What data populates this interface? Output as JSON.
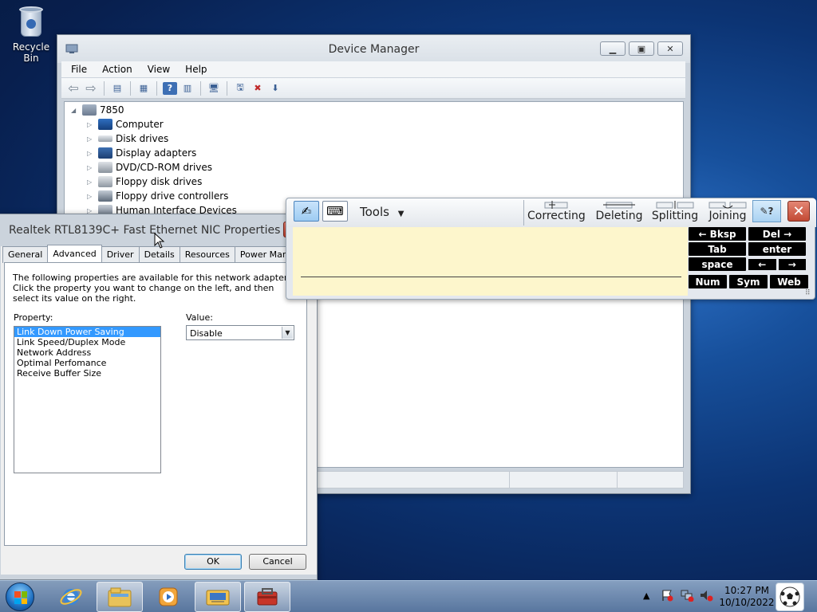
{
  "desktop": {
    "recycle_bin_label": "Recycle Bin"
  },
  "device_manager": {
    "title": "Device Manager",
    "menu": [
      "File",
      "Action",
      "View",
      "Help"
    ],
    "tree_root": "7850",
    "tree_items": [
      "Computer",
      "Disk drives",
      "Display adapters",
      "DVD/CD-ROM drives",
      "Floppy disk drives",
      "Floppy drive controllers",
      "Human Interface Devices"
    ]
  },
  "properties": {
    "title": "Realtek RTL8139C+ Fast Ethernet NIC Properties",
    "tabs": [
      "General",
      "Advanced",
      "Driver",
      "Details",
      "Resources",
      "Power Management"
    ],
    "active_tab": "Advanced",
    "description": "The following properties are available for this network adapter. Click the property you want to change on the left, and then select its value on the right.",
    "property_label": "Property:",
    "value_label": "Value:",
    "property_list": [
      "Link Down Power Saving",
      "Link Speed/Duplex Mode",
      "Network Address",
      "Optimal Perfomance",
      "Receive Buffer Size"
    ],
    "selected_property": "Link Down Power Saving",
    "value": "Disable",
    "ok_label": "OK",
    "cancel_label": "Cancel"
  },
  "input_panel": {
    "tools_label": "Tools",
    "gestures": [
      "Correcting",
      "Deleting",
      "Splitting",
      "Joining"
    ],
    "keys": {
      "bksp": "← Bksp",
      "del": "Del →",
      "tab": "Tab",
      "enter": "enter",
      "space": "space",
      "left": "←",
      "right": "→",
      "num": "Num",
      "sym": "Sym",
      "web": "Web"
    }
  },
  "taskbar": {
    "time": "10:27 PM",
    "date": "10/10/2022"
  },
  "colors": {
    "selection": "#3399ff",
    "write_area": "#fdf6cc",
    "close_red": "#c24a34"
  }
}
